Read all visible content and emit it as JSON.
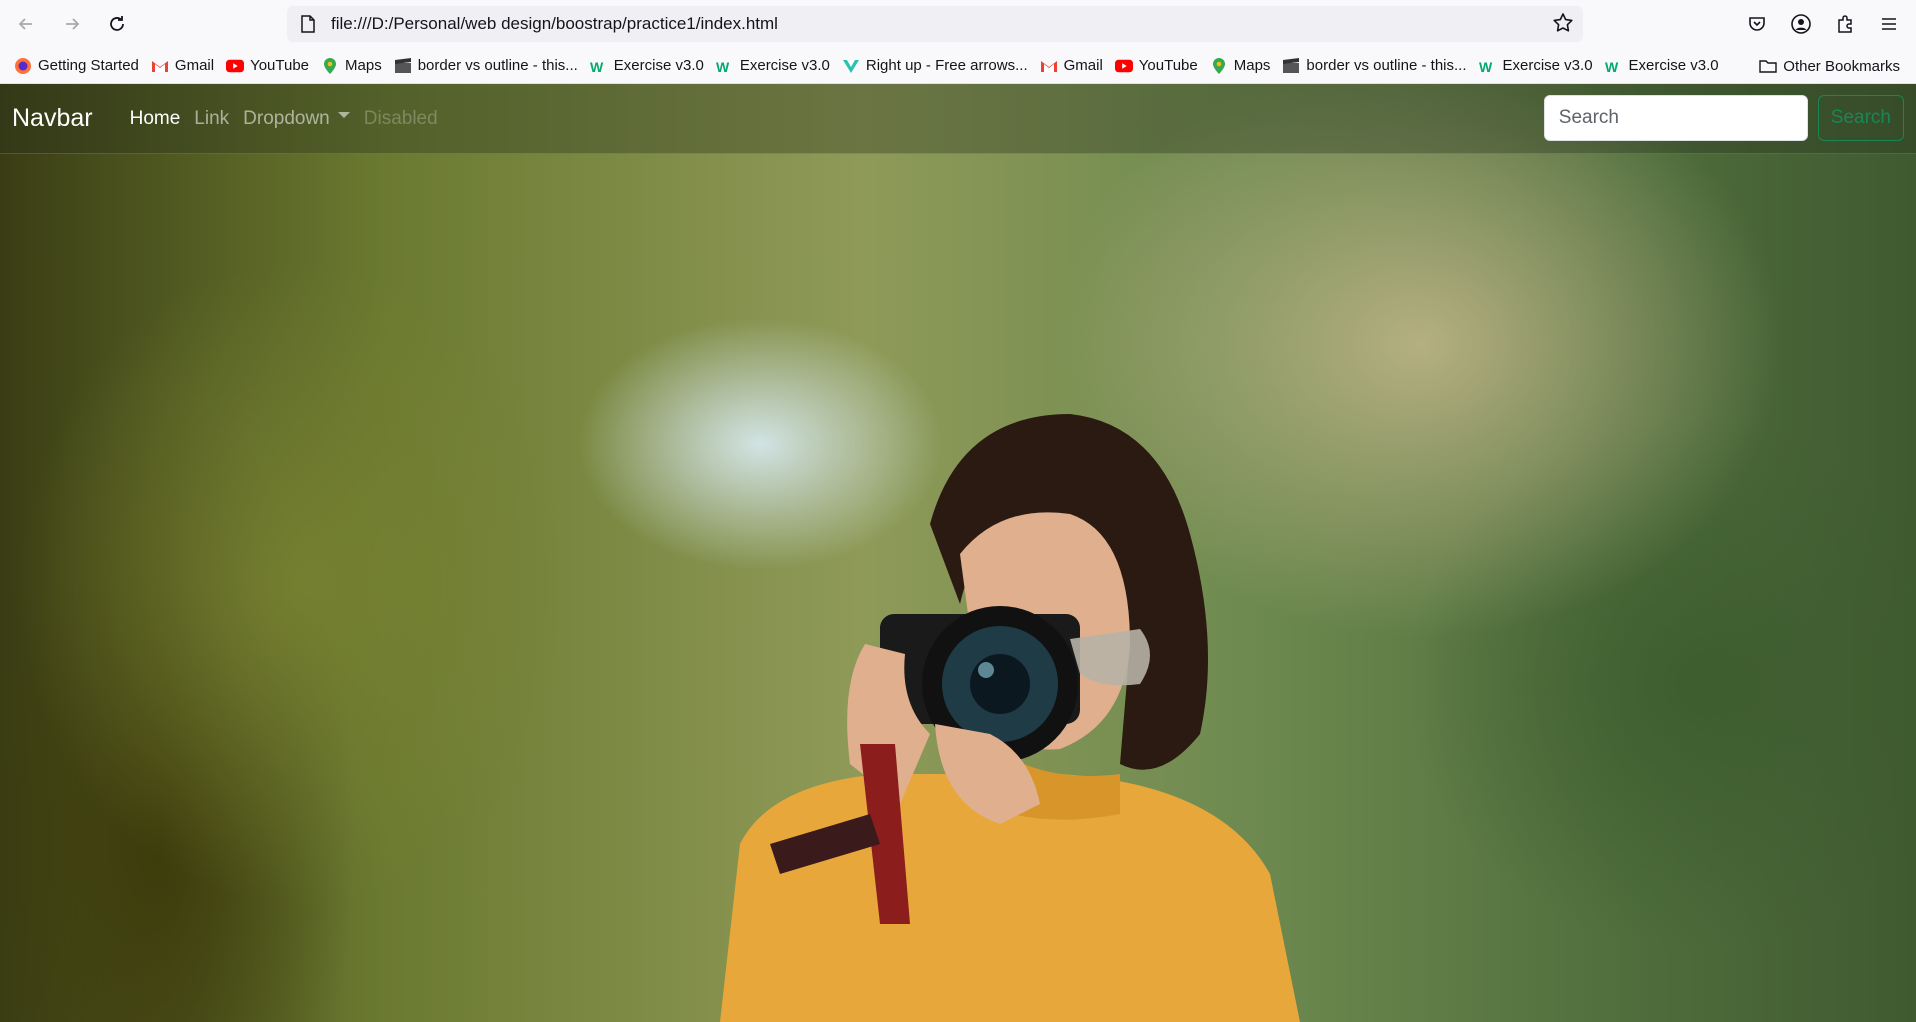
{
  "browser": {
    "url": "file:///D:/Personal/web design/boostrap/practice1/index.html",
    "bookmarks": [
      {
        "label": "Getting Started",
        "icon": "firefox-icon"
      },
      {
        "label": "Gmail",
        "icon": "gmail-icon"
      },
      {
        "label": "YouTube",
        "icon": "youtube-icon"
      },
      {
        "label": "Maps",
        "icon": "maps-icon"
      },
      {
        "label": "border vs outline - this...",
        "icon": "film-icon"
      },
      {
        "label": "Exercise v3.0",
        "icon": "w3schools-icon"
      },
      {
        "label": "Exercise v3.0",
        "icon": "w3schools-icon"
      },
      {
        "label": "Right up - Free arrows...",
        "icon": "arrow-site-icon"
      },
      {
        "label": "Gmail",
        "icon": "gmail-icon"
      },
      {
        "label": "YouTube",
        "icon": "youtube-icon"
      },
      {
        "label": "Maps",
        "icon": "maps-icon"
      },
      {
        "label": "border vs outline - this...",
        "icon": "film-icon"
      },
      {
        "label": "Exercise v3.0",
        "icon": "w3schools-icon"
      },
      {
        "label": "Exercise v3.0",
        "icon": "w3schools-icon"
      }
    ],
    "other_bookmarks": "Other Bookmarks"
  },
  "navbar": {
    "brand": "Navbar",
    "links": {
      "home": "Home",
      "link": "Link",
      "dropdown": "Dropdown",
      "disabled": "Disabled"
    },
    "search": {
      "placeholder": "Search",
      "button": "Search"
    }
  },
  "colors": {
    "accent_green": "#198754",
    "search_border": "#dee2e6"
  }
}
